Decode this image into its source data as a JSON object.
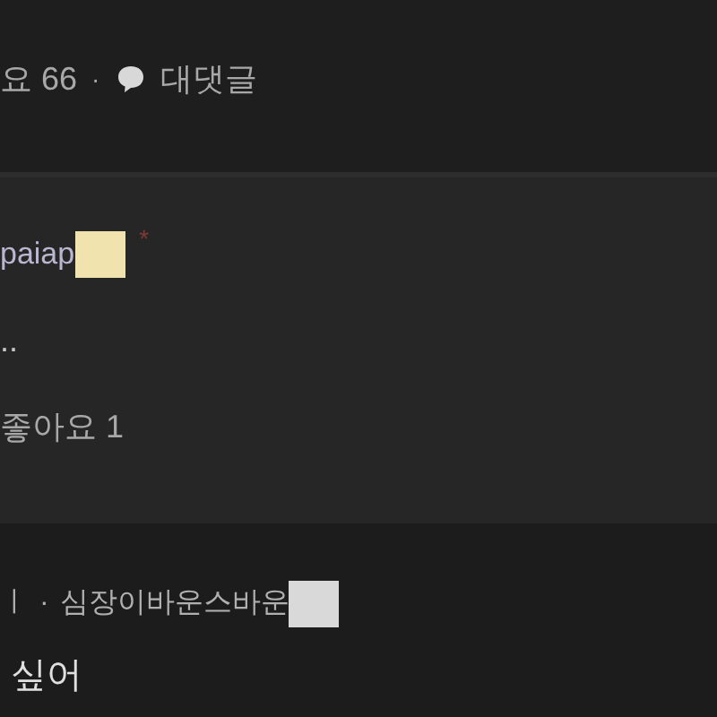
{
  "post_meta": {
    "likes": "요 66",
    "separator": "·",
    "reply_label": "대댓글"
  },
  "reply": {
    "author": "paiap",
    "mark": "*",
    "body": "..",
    "likes": "좋아요 1"
  },
  "next_comment": {
    "prefix": "ㅣ",
    "separator": "·",
    "author": "심장이바운스바운",
    "body": "싶어"
  }
}
